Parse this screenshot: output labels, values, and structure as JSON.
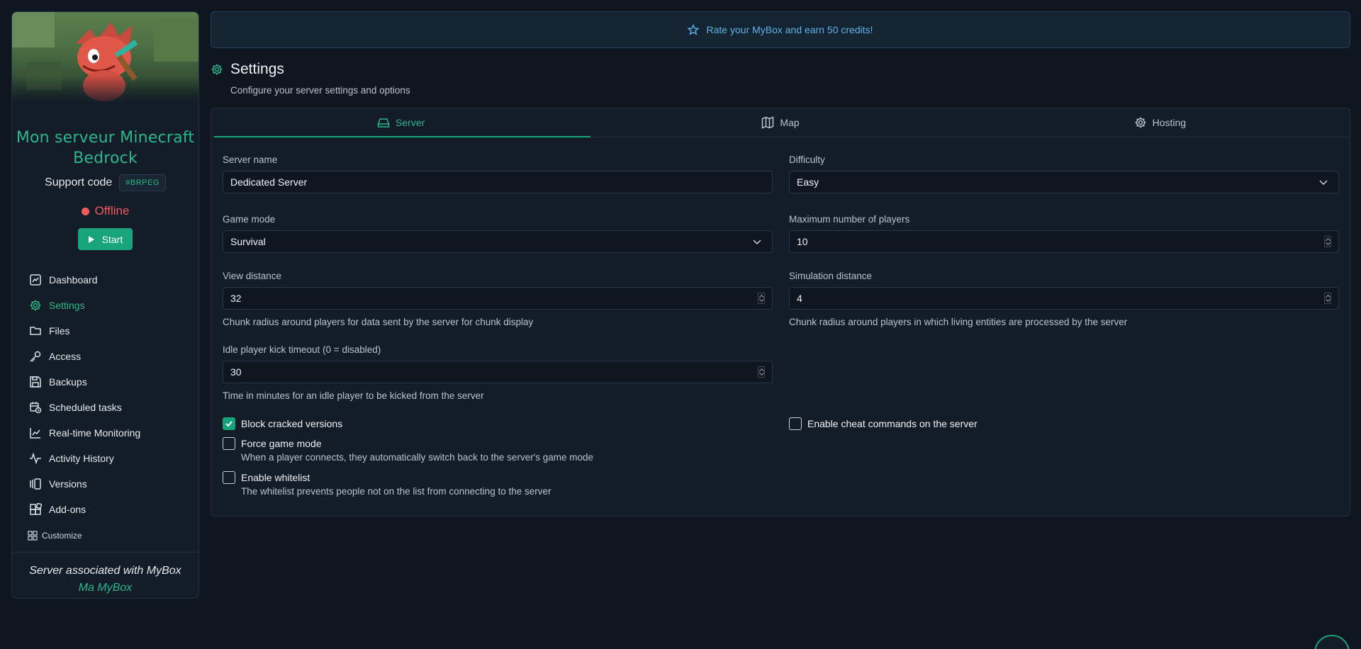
{
  "sidebar": {
    "server_name_line1": "Mon serveur Minecraft",
    "server_name_line2": "Bedrock",
    "support_label": "Support code",
    "support_code": "#BRPEG",
    "status": "Offline",
    "start_label": "Start",
    "nav": [
      {
        "label": "Dashboard",
        "icon": "dashboard-icon"
      },
      {
        "label": "Settings",
        "icon": "gear-icon",
        "active": true
      },
      {
        "label": "Files",
        "icon": "folder-icon"
      },
      {
        "label": "Access",
        "icon": "key-icon"
      },
      {
        "label": "Backups",
        "icon": "save-icon"
      },
      {
        "label": "Scheduled tasks",
        "icon": "calendar-clock-icon"
      },
      {
        "label": "Real-time Monitoring",
        "icon": "chart-line-icon"
      },
      {
        "label": "Activity History",
        "icon": "activity-icon"
      },
      {
        "label": "Versions",
        "icon": "versions-icon"
      },
      {
        "label": "Add-ons",
        "icon": "blocks-icon"
      }
    ],
    "customize_label": "Customize",
    "assoc_text": "Server associated with MyBox",
    "assoc_box": "Ma MyBox"
  },
  "promo": {
    "text": "Rate your MyBox and earn 50 credits!"
  },
  "page": {
    "title": "Settings",
    "subtitle": "Configure your server settings and options"
  },
  "tabs": [
    {
      "label": "Server",
      "icon": "drive-icon",
      "active": true
    },
    {
      "label": "Map",
      "icon": "map-icon"
    },
    {
      "label": "Hosting",
      "icon": "gear-icon"
    }
  ],
  "form": {
    "server_name": {
      "label": "Server name",
      "value": "Dedicated Server"
    },
    "difficulty": {
      "label": "Difficulty",
      "value": "Easy"
    },
    "game_mode": {
      "label": "Game mode",
      "value": "Survival"
    },
    "max_players": {
      "label": "Maximum number of players",
      "value": "10"
    },
    "view_distance": {
      "label": "View distance",
      "value": "32",
      "help": "Chunk radius around players for data sent by the server for chunk display"
    },
    "simulation_distance": {
      "label": "Simulation distance",
      "value": "4",
      "help": "Chunk radius around players in which living entities are processed by the server"
    },
    "idle_timeout": {
      "label": "Idle player kick timeout (0 = disabled)",
      "value": "30",
      "help": "Time in minutes for an idle player to be kicked from the server"
    },
    "block_cracked": {
      "label": "Block cracked versions",
      "checked": true
    },
    "cheats": {
      "label": "Enable cheat commands on the server",
      "checked": false
    },
    "force_gamemode": {
      "label": "Force game mode",
      "desc": "When a player connects, they automatically switch back to the server's game mode",
      "checked": false
    },
    "whitelist": {
      "label": "Enable whitelist",
      "desc": "The whitelist prevents people not on the list from connecting to the server",
      "checked": false
    }
  },
  "colors": {
    "accent": "#18a47a",
    "accent_text": "#2bb88a",
    "offline": "#ef5b5b",
    "promo": "#5fb3e6",
    "bg": "#0f161f"
  }
}
